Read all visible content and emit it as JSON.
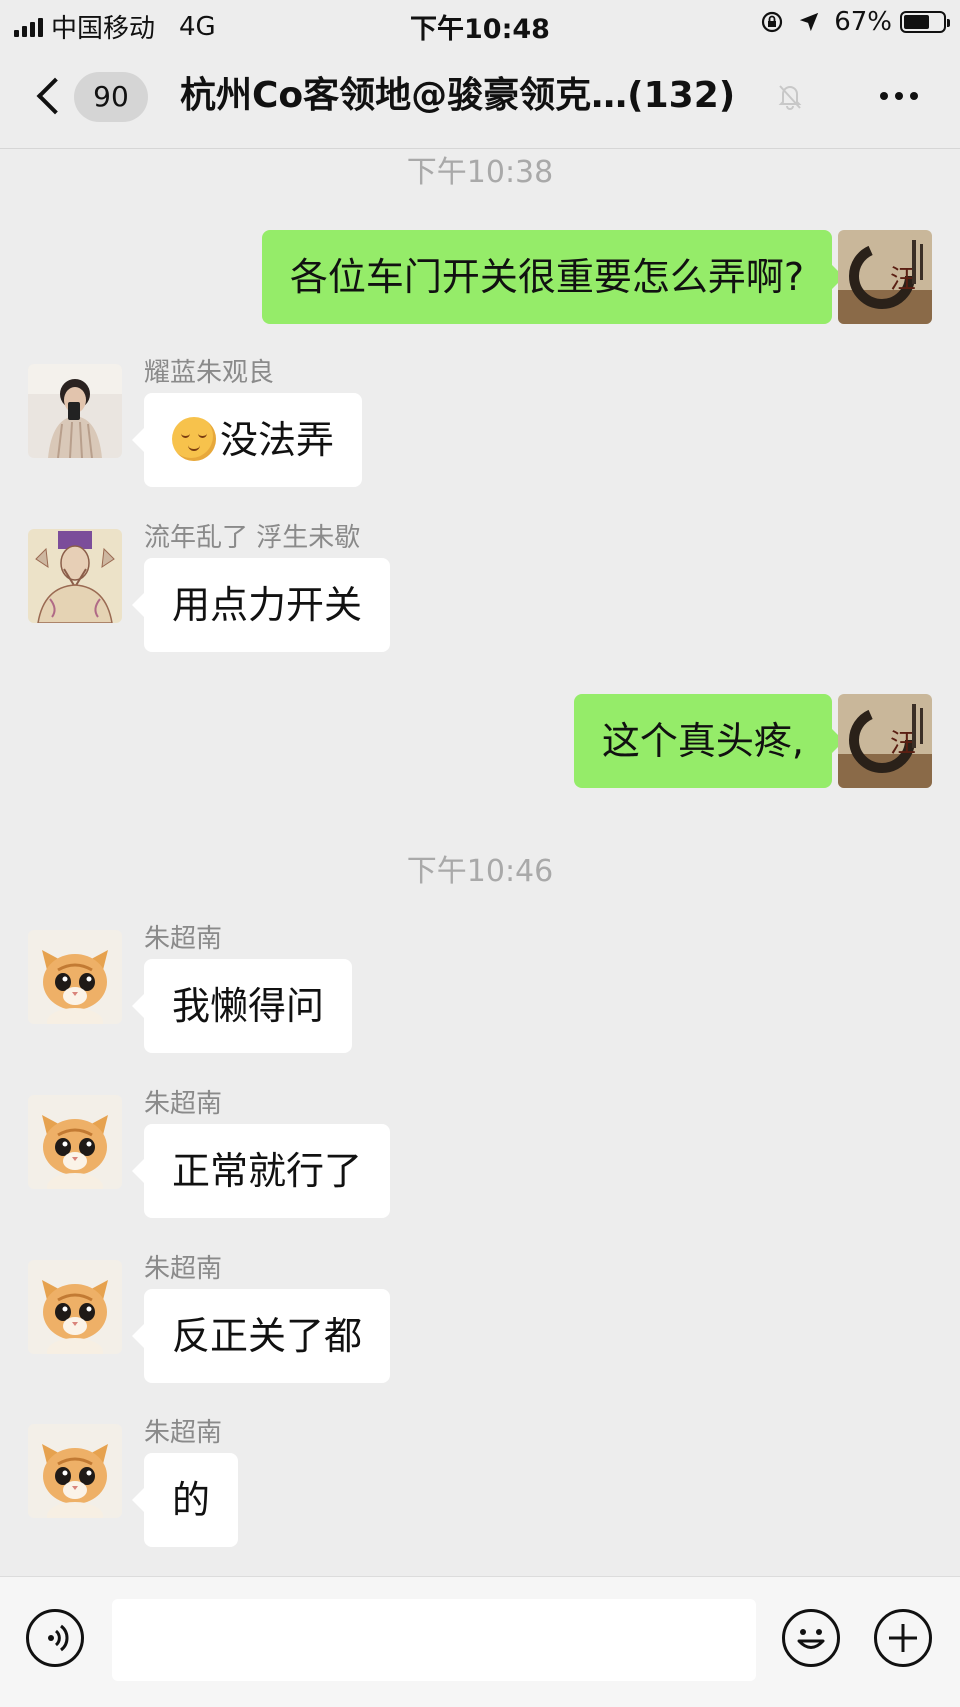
{
  "status_bar": {
    "carrier": "中国移动",
    "network": "4G",
    "time": "下午10:48",
    "battery": "67%",
    "battery_level": 0.67
  },
  "nav": {
    "back_count": "90",
    "title": "杭州Co客领地@骏豪领克…(132)"
  },
  "messages": [
    {
      "type": "timestamp",
      "text": "下午10:38"
    },
    {
      "type": "outgoing",
      "text": "各位车门开关很重要怎么弄啊?",
      "avatar": "ink-calligraphy-avatar"
    },
    {
      "type": "incoming",
      "sender": "耀蓝朱观良",
      "emoji": "smiling-face-emoji",
      "text": "没法弄",
      "avatar": "person-selfie-avatar"
    },
    {
      "type": "incoming",
      "sender": "流年乱了 浮生未歇",
      "text": "用点力开关",
      "avatar": "sketch-figure-avatar"
    },
    {
      "type": "outgoing",
      "text": "这个真头疼,",
      "avatar": "ink-calligraphy-avatar"
    },
    {
      "type": "timestamp",
      "text": "下午10:46"
    },
    {
      "type": "incoming",
      "sender": "朱超南",
      "text": "我懒得问",
      "avatar": "kitten-avatar"
    },
    {
      "type": "incoming",
      "sender": "朱超南",
      "text": "正常就行了",
      "avatar": "kitten-avatar"
    },
    {
      "type": "incoming",
      "sender": "朱超南",
      "text": "反正关了都",
      "avatar": "kitten-avatar"
    },
    {
      "type": "incoming",
      "sender": "朱超南",
      "text": "的",
      "avatar": "kitten-avatar"
    }
  ],
  "input_bar": {
    "value": ""
  },
  "colors": {
    "background": "#ededed",
    "outgoing_bubble": "#95ec69",
    "incoming_bubble": "#ffffff",
    "meta_text": "#8a8a8a"
  }
}
